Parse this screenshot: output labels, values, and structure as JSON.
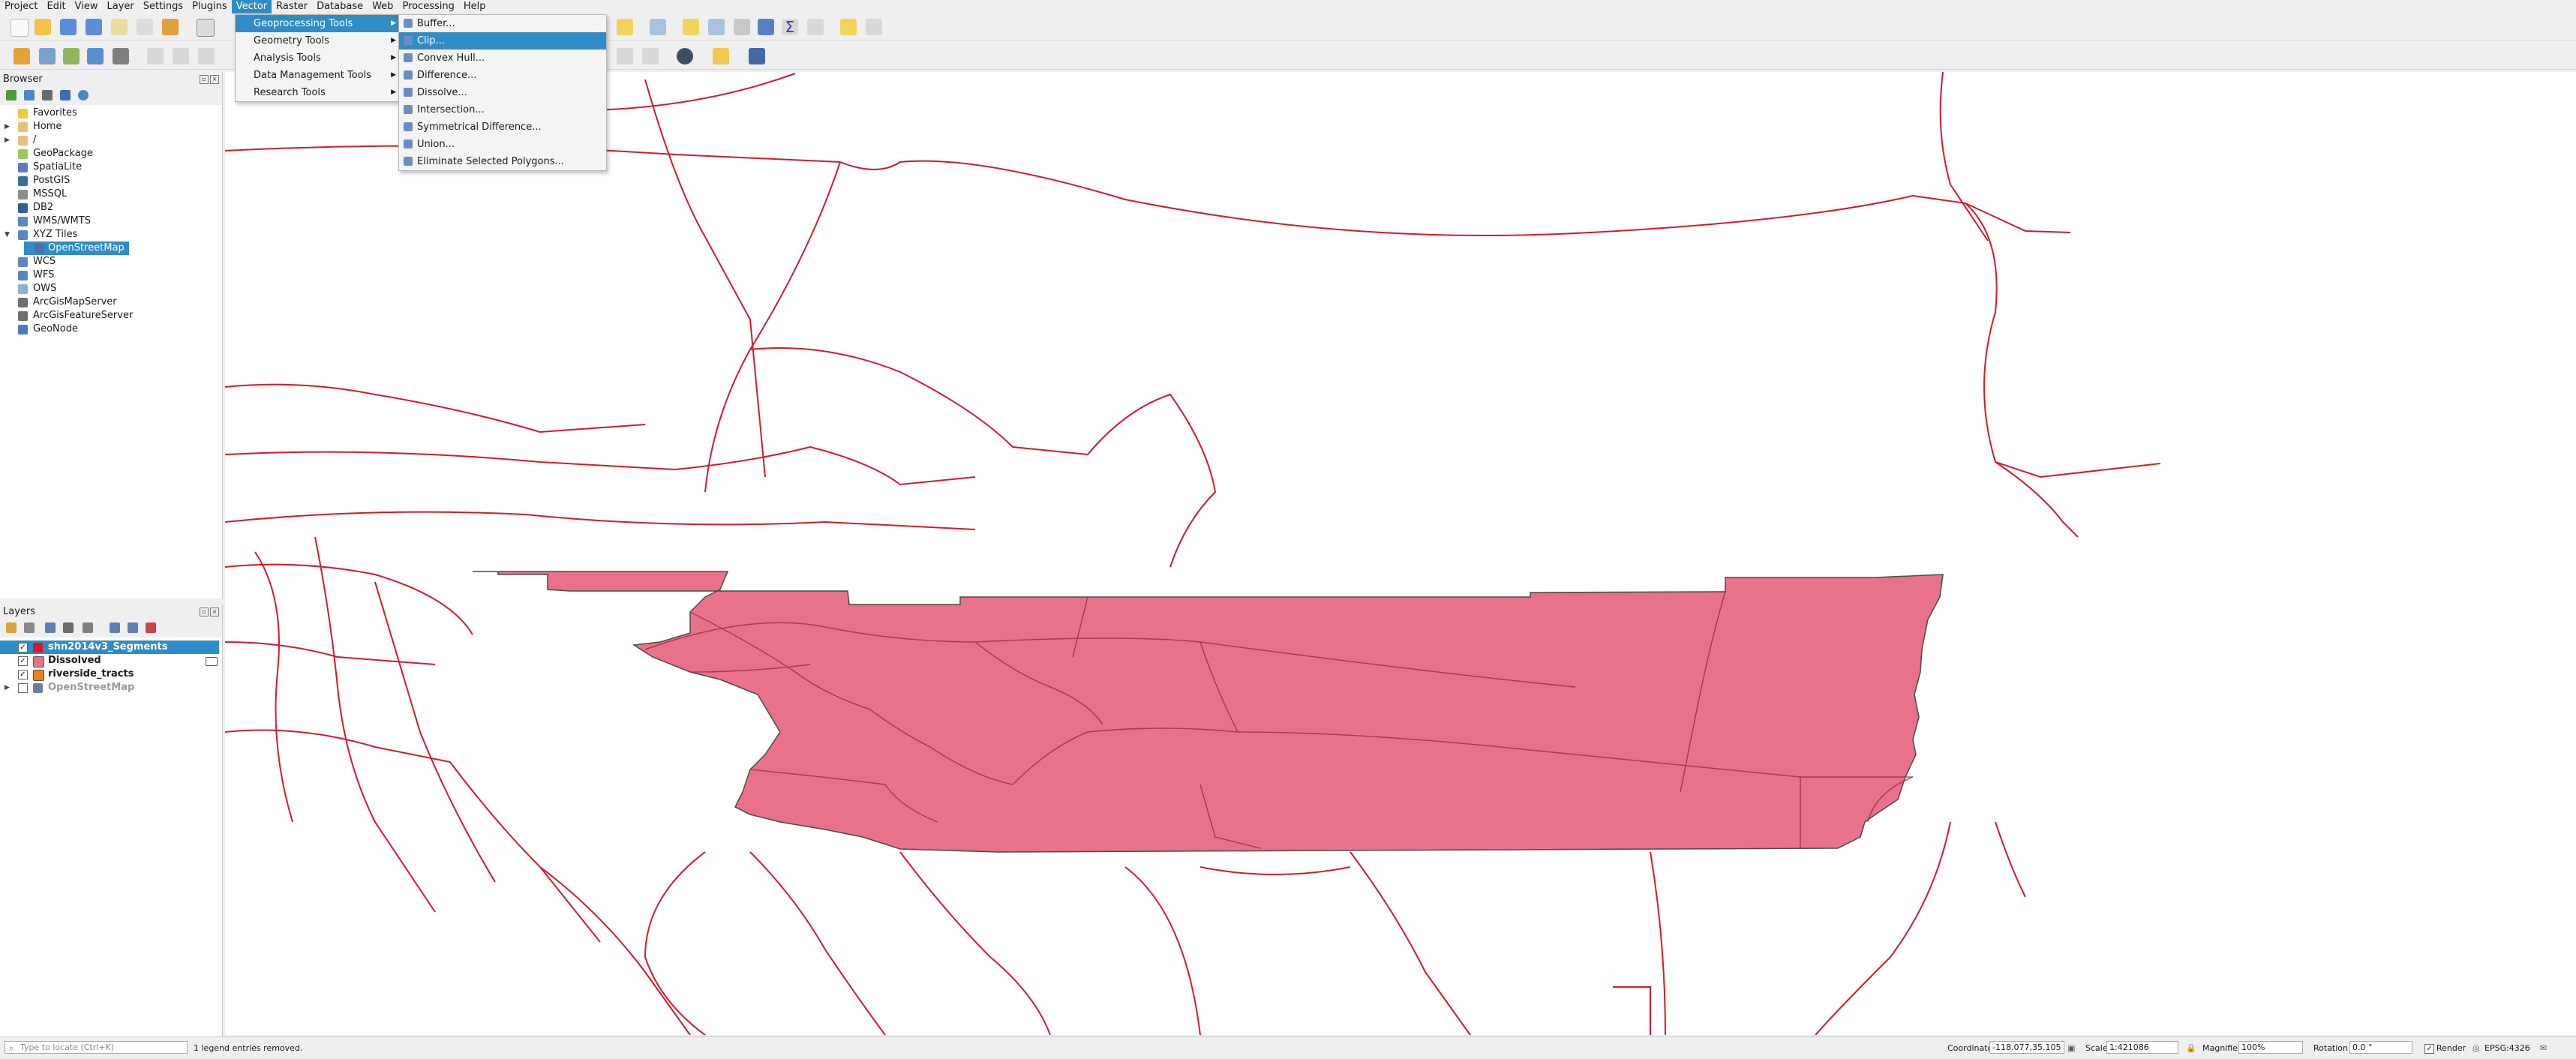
{
  "menubar": [
    "Project",
    "Edit",
    "View",
    "Layer",
    "Settings",
    "Plugins",
    "Vector",
    "Raster",
    "Database",
    "Web",
    "Processing",
    "Help"
  ],
  "menubar_active": "Vector",
  "vector_menu": [
    "Geoprocessing Tools",
    "Geometry Tools",
    "Analysis Tools",
    "Data Management Tools",
    "Research Tools"
  ],
  "geoprocessing_menu": [
    "Buffer...",
    "Clip...",
    "Convex Hull...",
    "Difference...",
    "Dissolve...",
    "Intersection...",
    "Symmetrical Difference...",
    "Union...",
    "Eliminate Selected Polygons..."
  ],
  "browser": {
    "title": "Browser",
    "items": [
      "Favorites",
      "Home",
      "/",
      "GeoPackage",
      "SpatiaLite",
      "PostGIS",
      "MSSQL",
      "DB2",
      "WMS/WMTS",
      "XYZ Tiles",
      "OpenStreetMap",
      "WCS",
      "WFS",
      "OWS",
      "ArcGisMapServer",
      "ArcGisFeatureServer",
      "GeoNode"
    ],
    "selected": "OpenStreetMap"
  },
  "layers": {
    "title": "Layers",
    "items": [
      {
        "name": "shn2014v3_Segments",
        "checked": true,
        "bold": true,
        "selected": true,
        "color": "#d6182a"
      },
      {
        "name": "Dissolved",
        "checked": true,
        "bold": true,
        "color": "#e8728a"
      },
      {
        "name": "riverside_tracts",
        "checked": true,
        "bold": true,
        "color": "#f07f13"
      },
      {
        "name": "OpenStreetMap",
        "checked": false,
        "bold": true,
        "color": "#888888"
      }
    ]
  },
  "status": {
    "locate_placeholder": "Type to locate (Ctrl+K)",
    "message": "1 legend entries removed.",
    "coordinate_label": "Coordinate",
    "coordinate": "-118.077,35.105",
    "scale_label": "Scale",
    "scale": "1:421086",
    "magnifier_label": "Magnifier",
    "magnifier": "100%",
    "rotation_label": "Rotation",
    "rotation": "0.0 °",
    "render_label": "Render",
    "crs": "EPSG:4326"
  },
  "colors": {
    "accent": "#308cc6",
    "polygon_fill": "#e8728a",
    "road_line": "#d6182a"
  }
}
